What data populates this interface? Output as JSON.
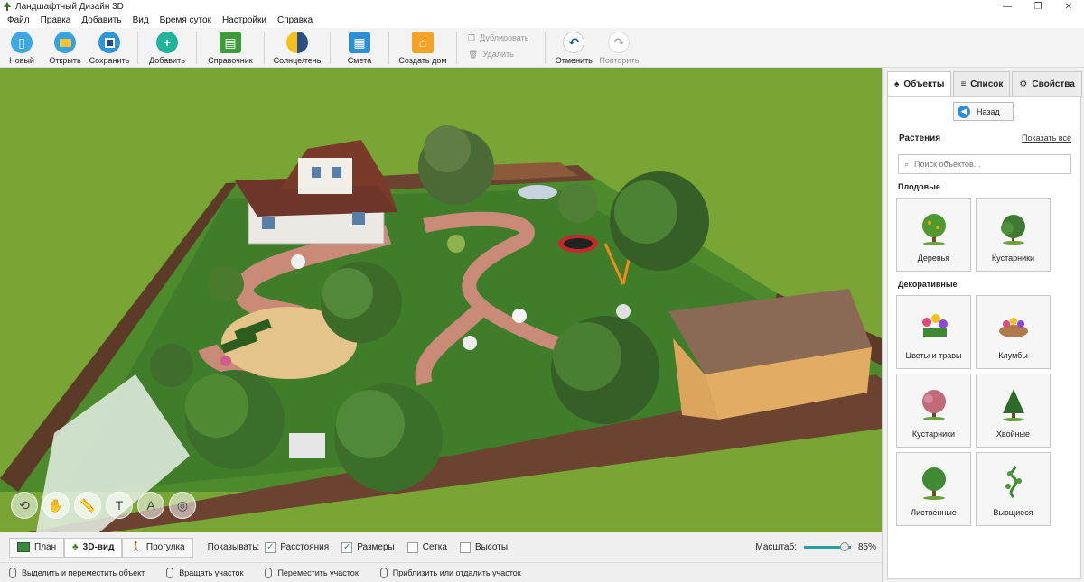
{
  "window": {
    "title": "Ландшафтный Дизайн 3D",
    "controls": [
      "—",
      "❐",
      "✕"
    ]
  },
  "menu": [
    "Файл",
    "Правка",
    "Добавить",
    "Вид",
    "Время суток",
    "Настройки",
    "Справка"
  ],
  "toolbar": {
    "new": "Новый",
    "open": "Открыть",
    "save": "Сохранить",
    "add": "Добавить",
    "guide": "Справочник",
    "sun": "Солнце/тень",
    "estimate": "Смета",
    "house": "Создать дом",
    "duplicate": "Дублировать",
    "delete": "Удалить",
    "undo": "Отменить",
    "redo": "Повторить"
  },
  "view_modes": {
    "plan": "План",
    "view3d": "3D-вид",
    "walk": "Прогулка",
    "active": "3D-вид"
  },
  "show": {
    "label": "Показывать:",
    "distances": {
      "label": "Расстояния",
      "checked": true
    },
    "sizes": {
      "label": "Размеры",
      "checked": true
    },
    "grid": {
      "label": "Сетка",
      "checked": false
    },
    "heights": {
      "label": "Высоты",
      "checked": false
    }
  },
  "zoom": {
    "label": "Масштаб:",
    "value": "85%",
    "percent": 85
  },
  "status": [
    "Выделить и переместить объект",
    "Вращать участок",
    "Переместить участок",
    "Приблизить или отдалить участок"
  ],
  "panel": {
    "tabs": [
      "Объекты",
      "Список",
      "Свойства"
    ],
    "active_tab": "Объекты",
    "back": "Назад",
    "section": "Растения",
    "show_all": "Показать все",
    "search_placeholder": "Поиск объектов...",
    "categories": [
      {
        "title": "Плодовые",
        "items": [
          "Деревья",
          "Кустарники"
        ]
      },
      {
        "title": "Декоративные",
        "items": [
          "Цветы и травы",
          "Клумбы",
          "Кустарники",
          "Хвойные",
          "Лиственные",
          "Вьющиеся"
        ]
      }
    ]
  },
  "colors": {
    "grass": "#77a432",
    "lawn": "#3f7d2a",
    "path": "#c98a78",
    "fence": "#6b4330",
    "accent": "#2a9da6"
  }
}
